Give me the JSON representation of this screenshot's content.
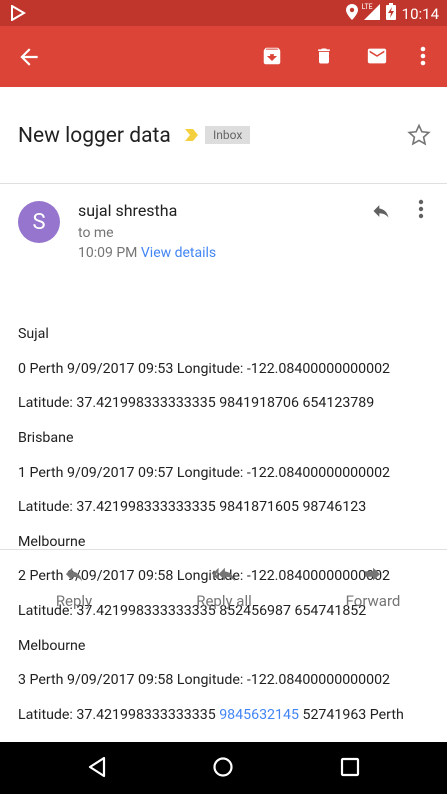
{
  "status": {
    "time": "10:14",
    "network": "LTE"
  },
  "toolbar": {
    "back": "back-arrow",
    "archive": "archive-icon",
    "delete": "trash-icon",
    "mark": "mail-icon",
    "more": "more-vert-icon"
  },
  "email": {
    "subject": "New logger data",
    "label": "Inbox",
    "sender_initial": "S",
    "sender_name": "sujal shrestha",
    "recipient": "to me",
    "time": "10:09 PM",
    "view_details": "View details",
    "body_lines": [
      "Sujal",
      "0 Perth 9/09/2017 09:53 Longitude: -122.08400000000002",
      "Latitude: 37.421998333333335 9841918706 654123789",
      "Brisbane",
      "1 Perth 9/09/2017 09:57 Longitude: -122.08400000000002",
      "Latitude: 37.421998333333335 9841871605 98746123",
      "Melbourne",
      "2 Perth 9/09/2017 09:58 Longitude: -122.08400000000002",
      "Latitude: 37.421998333333335 852456987 654741852",
      "Melbourne",
      "3 Perth 9/09/2017 09:58 Longitude: -122.08400000000002"
    ],
    "last_line_prefix": "Latitude: 37.421998333333335 ",
    "last_line_phone": "9845632145",
    "last_line_suffix": " 52741963 Perth"
  },
  "actions": {
    "reply": "Reply",
    "reply_all": "Reply all",
    "forward": "Forward"
  },
  "colors": {
    "toolbar": "#db4437",
    "statusbar": "#c0362c",
    "avatar": "#9575cd",
    "link": "#4285f4"
  }
}
